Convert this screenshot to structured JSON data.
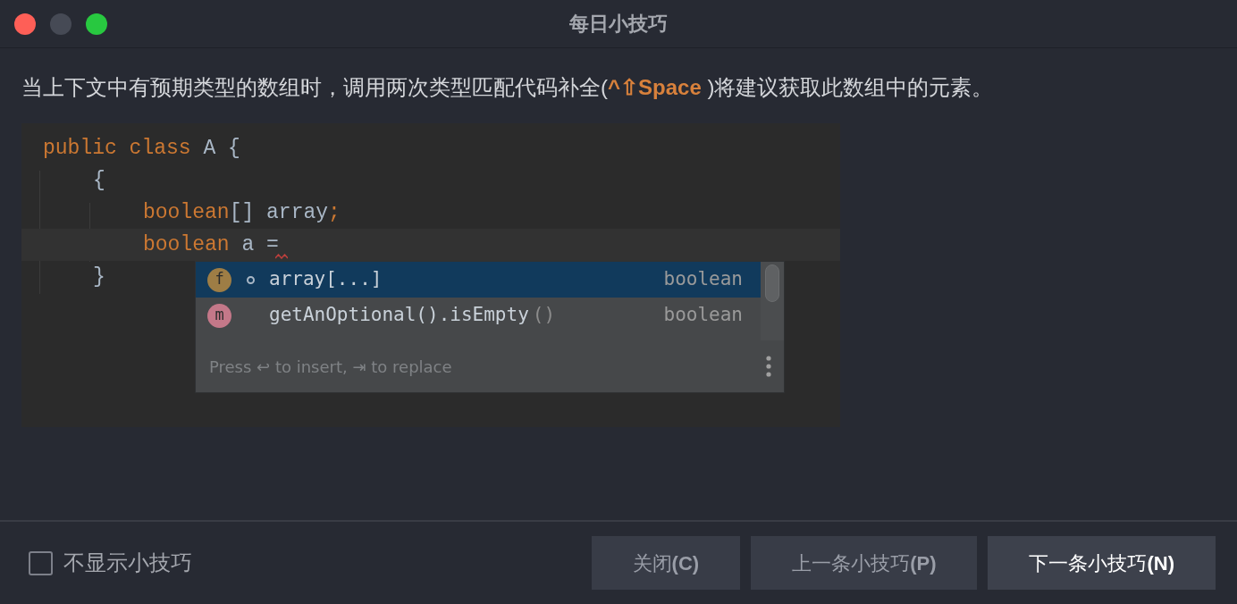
{
  "window": {
    "title": "每日小技巧"
  },
  "tip": {
    "before": "当上下文中有预期类型的数组时，调用两次类型匹配代码补全(",
    "shortcut": "^⇧Space",
    "after": ")将建议获取此数组中的元素。"
  },
  "code": {
    "lines": [
      {
        "current": false,
        "error": false,
        "tokens": [
          {
            "kind": "keyword",
            "text": "public class"
          },
          {
            "kind": "plain",
            "text": " A {"
          }
        ],
        "children": [
          {
            "current": false,
            "error": false,
            "tokens": [
              {
                "kind": "plain",
                "text": "{"
              }
            ],
            "children": [
              {
                "current": false,
                "error": false,
                "tokens": [
                  {
                    "kind": "keyword",
                    "text": "boolean"
                  },
                  {
                    "kind": "plain",
                    "text": "[] array"
                  },
                  {
                    "kind": "keyword",
                    "text": ";"
                  }
                ]
              },
              {
                "current": true,
                "error": true,
                "tokens": [
                  {
                    "kind": "keyword",
                    "text": "boolean"
                  },
                  {
                    "kind": "plain",
                    "text": " a ="
                  }
                ]
              }
            ]
          },
          {
            "current": false,
            "error": false,
            "tokens": [
              {
                "kind": "plain",
                "text": "}"
              }
            ]
          }
        ]
      }
    ]
  },
  "completion": {
    "items": [
      {
        "kind": "field",
        "icon": "f",
        "static": true,
        "name": "array[...]",
        "type": "boolean",
        "selected": true
      },
      {
        "kind": "method",
        "icon": "m",
        "static": false,
        "name": "getAnOptional().isEmpty",
        "suffix": "()",
        "type": "boolean",
        "selected": false
      }
    ],
    "hint": "Press ↩ to insert, ⇥ to replace"
  },
  "footer": {
    "checkbox": {
      "label": "不显示小技巧",
      "checked": false
    },
    "buttons": [
      {
        "label": "关闭**(C)**",
        "default": false
      },
      {
        "label": "上一条小技巧**(P)**",
        "default": false
      },
      {
        "label": "下一条小技巧**(N)**",
        "default": true
      }
    ]
  }
}
